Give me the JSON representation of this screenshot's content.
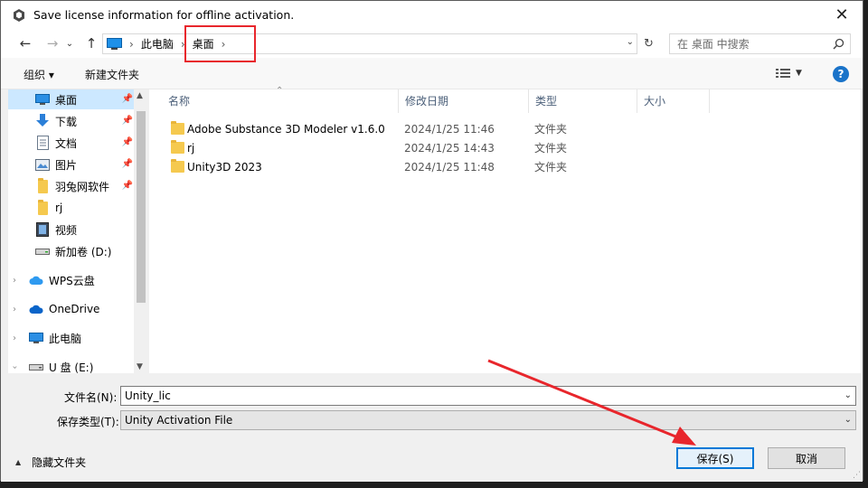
{
  "window": {
    "title": "Save license information for offline activation."
  },
  "address_bar": {
    "crumbs": [
      "此电脑",
      "桌面"
    ]
  },
  "search": {
    "placeholder": "在 桌面 中搜索"
  },
  "toolbar": {
    "organize_label": "组织 ▾",
    "new_folder_label": "新建文件夹"
  },
  "sidebar": {
    "items": [
      {
        "label": "桌面",
        "icon": "desktop-icon",
        "selected": true,
        "pinned": true
      },
      {
        "label": "下载",
        "icon": "download-icon",
        "pinned": true
      },
      {
        "label": "文档",
        "icon": "document-icon",
        "pinned": true
      },
      {
        "label": "图片",
        "icon": "pictures-icon",
        "pinned": true
      },
      {
        "label": "羽兔网软件",
        "icon": "folder-icon",
        "pinned": true
      },
      {
        "label": "rj",
        "icon": "folder-icon"
      },
      {
        "label": "视频",
        "icon": "video-icon"
      },
      {
        "label": "新加卷 (D:)",
        "icon": "drive-icon"
      },
      {
        "label": "WPS云盘",
        "icon": "cloud-icon",
        "expandable": true
      },
      {
        "label": "OneDrive",
        "icon": "onedrive-icon",
        "expandable": true
      },
      {
        "label": "此电脑",
        "icon": "computer-icon",
        "expandable": true
      },
      {
        "label": "U 盘 (E:)",
        "icon": "usb-drive-icon",
        "expandable": true
      }
    ]
  },
  "file_list": {
    "columns": [
      "名称",
      "修改日期",
      "类型",
      "大小"
    ],
    "rows": [
      {
        "name": "Adobe Substance 3D Modeler v1.6.0",
        "date": "2024/1/25 11:46",
        "type": "文件夹"
      },
      {
        "name": "rj",
        "date": "2024/1/25 14:43",
        "type": "文件夹"
      },
      {
        "name": "Unity3D 2023",
        "date": "2024/1/25 11:48",
        "type": "文件夹"
      }
    ]
  },
  "form": {
    "filename_label": "文件名(N):",
    "filename_value": "Unity_lic",
    "filetype_label": "保存类型(T):",
    "filetype_value": "Unity Activation File",
    "hide_folders_label": "隐藏文件夹",
    "save_label": "保存(S)",
    "cancel_label": "取消"
  },
  "colors": {
    "annotation_red": "#e8262c",
    "selection_blue": "#cce8ff",
    "accent": "#0078d7"
  }
}
